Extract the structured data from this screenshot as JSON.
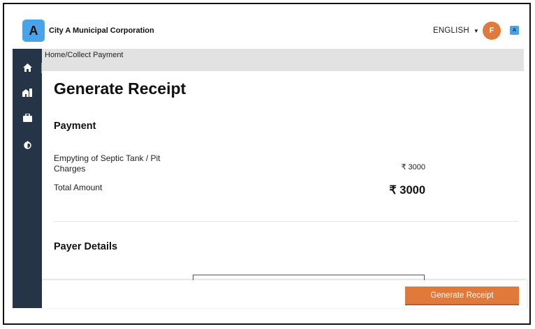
{
  "header": {
    "logo_letter": "A",
    "city_name": "City A Municipal Corporation",
    "language": "ENGLISH",
    "avatar_letter": "F",
    "badge_letter": "A"
  },
  "sidebar": {
    "items": [
      {
        "icon": "home-icon",
        "active": true
      },
      {
        "icon": "building-icon",
        "active": false
      },
      {
        "icon": "briefcase-icon",
        "active": false
      },
      {
        "icon": "drop-icon",
        "active": false
      }
    ]
  },
  "breadcrumb": "Home/Collect Payment",
  "page": {
    "title": "Generate Receipt",
    "payment": {
      "section_title": "Payment",
      "fee_label": "Empyting of Septic Tank / Pit Charges",
      "fee_amount": "₹ 3000",
      "total_label": "Total Amount",
      "total_amount": "₹ 3000"
    },
    "payer": {
      "section_title": "Payer Details"
    }
  },
  "footer": {
    "generate_button_label": "Generate Receipt"
  },
  "colors": {
    "sidebar": "#253446",
    "accent": "#e07a3a",
    "logo": "#4aa3e6",
    "breadcrumb_bg": "#e2e2e2"
  }
}
